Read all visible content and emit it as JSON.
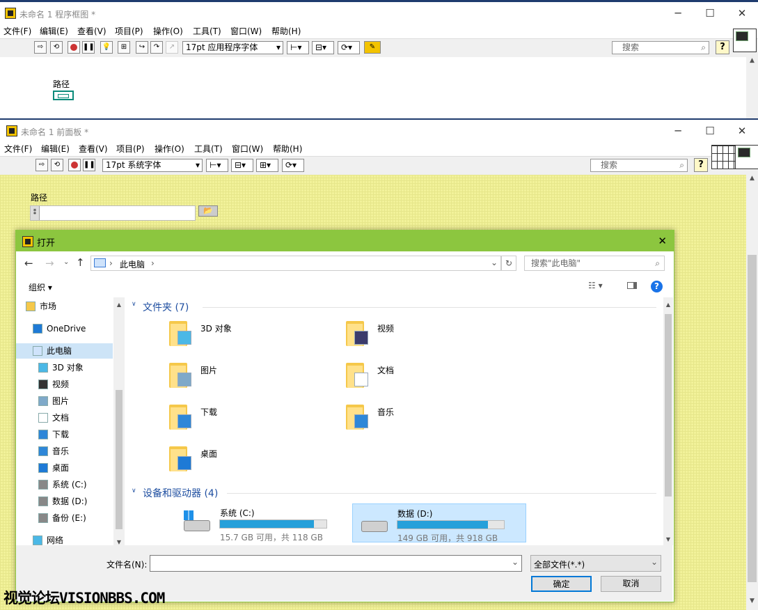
{
  "block_diagram": {
    "title": "未命名 1 程序框图 *",
    "menu": [
      "文件(F)",
      "编辑(E)",
      "查看(V)",
      "项目(P)",
      "操作(O)",
      "工具(T)",
      "窗口(W)",
      "帮助(H)"
    ],
    "font_select": "17pt 应用程序字体",
    "search_placeholder": "搜索",
    "help_button": "?",
    "terminal_label": "路径"
  },
  "front_panel": {
    "title": "未命名 1 前面板 *",
    "menu": [
      "文件(F)",
      "编辑(E)",
      "查看(V)",
      "项目(P)",
      "操作(O)",
      "工具(T)",
      "窗口(W)",
      "帮助(H)"
    ],
    "font_select": "17pt 系统字体",
    "search_placeholder": "搜索",
    "help_button": "?",
    "control_label": "路径",
    "path_value": ""
  },
  "dialog": {
    "title": "打开",
    "close": "✕",
    "breadcrumb": [
      "此电脑"
    ],
    "search_placeholder": "搜索\"此电脑\"",
    "organize": "组织 ▾",
    "nav_items": [
      {
        "label": "市场",
        "icon": "folder-icon"
      },
      {
        "label": "OneDrive",
        "icon": "cloud-icon"
      },
      {
        "label": "此电脑",
        "icon": "computer-icon"
      },
      {
        "label": "3D 对象",
        "icon": "cube-icon"
      },
      {
        "label": "视频",
        "icon": "video-icon"
      },
      {
        "label": "图片",
        "icon": "picture-icon"
      },
      {
        "label": "文档",
        "icon": "document-icon"
      },
      {
        "label": "下载",
        "icon": "download-icon"
      },
      {
        "label": "音乐",
        "icon": "music-icon"
      },
      {
        "label": "桌面",
        "icon": "desktop-icon"
      },
      {
        "label": "系统 (C:)",
        "icon": "drive-icon"
      },
      {
        "label": "数据 (D:)",
        "icon": "drive-icon"
      },
      {
        "label": "备份 (E:)",
        "icon": "drive-icon"
      },
      {
        "label": "网络",
        "icon": "network-icon"
      }
    ],
    "folders_header": "文件夹 (7)",
    "folders": [
      {
        "label": "3D 对象",
        "icon": "cube-icon"
      },
      {
        "label": "视频",
        "icon": "video-icon"
      },
      {
        "label": "图片",
        "icon": "picture-icon"
      },
      {
        "label": "文档",
        "icon": "document-icon"
      },
      {
        "label": "下载",
        "icon": "download-icon"
      },
      {
        "label": "音乐",
        "icon": "music-icon"
      },
      {
        "label": "桌面",
        "icon": "desktop-icon"
      }
    ],
    "drives_header": "设备和驱动器 (4)",
    "drives": [
      {
        "label": "系统 (C:)",
        "free_text": "15.7 GB 可用，共 118 GB",
        "used_fraction": 0.87
      },
      {
        "label": "数据 (D:)",
        "free_text": "149 GB 可用，共 918 GB",
        "used_fraction": 0.84
      }
    ],
    "filename_label": "文件名(N):",
    "filename_value": "",
    "filter": "全部文件(*.*)",
    "ok": "确定",
    "cancel": "取消"
  },
  "watermark": "视觉论坛VISIONBBS.COM"
}
